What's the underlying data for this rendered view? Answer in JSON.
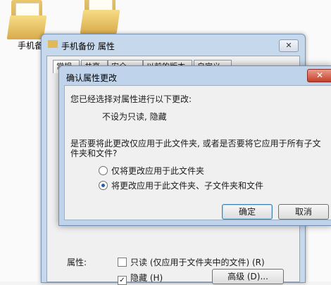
{
  "desktop": {
    "folders": [
      {
        "label": "手机备"
      },
      {
        "label": ""
      }
    ]
  },
  "properties_window": {
    "title": "手机备份 属性",
    "close_label": "✕",
    "tabs": [
      "常规",
      "共享",
      "安全",
      "以前的版本",
      "自定义"
    ],
    "attributes_label": "属性:",
    "readonly_label": "只读 (仅应用于文件夹中的文件) (R)",
    "hidden_label": "隐藏 (H)",
    "hidden_checked": true,
    "advanced_label": "高级 (D)..."
  },
  "confirm_dialog": {
    "title": "确认属性更改",
    "close_label": "✕",
    "intro": "您已经选择对属性进行以下更改:",
    "changes": "不设为只读, 隐藏",
    "question_line1": "是否要将此更改仅应用于此文件夹, 或者是否要将它应用于所有子文",
    "question_line2": "件夹和文件?",
    "option_this_folder": "仅将更改应用于此文件夹",
    "option_all": "将更改应用于此文件夹、子文件夹和文件",
    "selected_option": "all",
    "ok_label": "确定",
    "cancel_label": "取消"
  }
}
